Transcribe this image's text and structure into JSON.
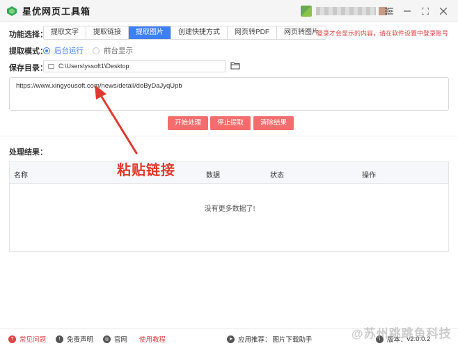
{
  "window": {
    "title": "星优网页工具箱",
    "controls": {
      "settings": "☰",
      "minimize": "—",
      "maximize": "⛶",
      "close": "✕"
    }
  },
  "function_row": {
    "label": "功能选择：",
    "tabs": [
      "提取文字",
      "提取链接",
      "提取图片",
      "创建快捷方式",
      "网页转PDF",
      "网页转图片"
    ],
    "active_index": 2,
    "login_note": "登录才会显示的内容，请在软件设置中登录账号"
  },
  "mode_row": {
    "label": "提取模式：",
    "options": [
      {
        "label": "后台运行",
        "selected": true
      },
      {
        "label": "前台显示",
        "selected": false
      }
    ]
  },
  "save_row": {
    "label": "保存目录：",
    "path": "C:\\Users\\yssoft1\\Desktop",
    "folder_icon": "folder-icon"
  },
  "url_input": {
    "value": "https://www.xingyousoft.com/news/detail/doByDaJyqUpb"
  },
  "actions": {
    "start": "开始处理",
    "stop": "停止提取",
    "clear": "清除结果"
  },
  "results": {
    "label": "处理结果：",
    "columns": [
      "名称",
      "数据",
      "状态",
      "操作"
    ],
    "empty_text": "没有更多数据了!"
  },
  "annotation": {
    "text": "粘贴链接"
  },
  "statusbar": {
    "faq": "常见问题",
    "disclaimer": "免责声明",
    "website": "官网",
    "tutorial": "使用教程",
    "recommend": "应用推荐：",
    "recommend_app": "图片下载助手",
    "version_prefix": "版本：",
    "version": "v2.0.0.2"
  },
  "watermark": "@苏州跳跳鱼科技",
  "colors": {
    "accent": "#3d7ff5",
    "button_red": "#f56c6c",
    "annotation_red": "#e03a2e",
    "warning_red": "#e04343"
  }
}
